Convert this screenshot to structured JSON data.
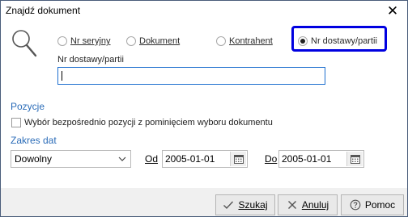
{
  "window": {
    "title": "Znajdź dokument",
    "close_label": "✕"
  },
  "search_type": {
    "options": [
      {
        "label": "Nr seryjny",
        "checked": false
      },
      {
        "label": "Dokument",
        "checked": false
      },
      {
        "label": "Kontrahent",
        "checked": false
      },
      {
        "label": "Nr dostawy/partii",
        "checked": true
      }
    ]
  },
  "search_field": {
    "label": "Nr dostawy/partii",
    "value": ""
  },
  "positions": {
    "section_title": "Pozycje",
    "direct_select_label": "Wybór bezpośrednio pozycji z pominięciem wyboru dokumentu",
    "direct_select_checked": false
  },
  "date_range": {
    "section_title": "Zakres dat",
    "mode_value": "Dowolny",
    "from_label": "Od",
    "from_value": "2005-01-01",
    "to_label": "Do",
    "to_value": "2005-01-01"
  },
  "buttons": {
    "search_label": "Szukaj",
    "cancel_label": "Anuluj",
    "help_label": "Pomoc"
  },
  "colors": {
    "accent": "#2b6cb8",
    "focus_outline": "#0000e0"
  }
}
